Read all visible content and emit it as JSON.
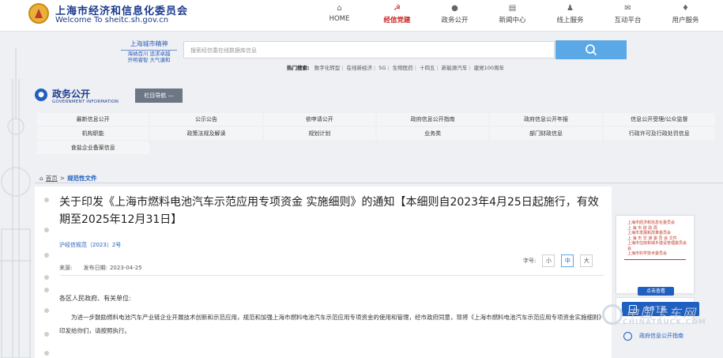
{
  "header": {
    "site_cn": "上海市经济和信息化委员会",
    "site_en": "Welcome To sheitc.sh.gov.cn",
    "nav": [
      {
        "label": "HOME",
        "icon": "home-icon",
        "active": false
      },
      {
        "label": "经信党建",
        "icon": "party-icon",
        "active": true
      },
      {
        "label": "政务公开",
        "icon": "chat-icon",
        "active": false
      },
      {
        "label": "新闻中心",
        "icon": "news-icon",
        "active": false
      },
      {
        "label": "线上服务",
        "icon": "service-icon",
        "active": false
      },
      {
        "label": "互动平台",
        "icon": "interact-icon",
        "active": false
      },
      {
        "label": "用户服务",
        "icon": "user-icon",
        "active": false
      }
    ]
  },
  "slogan": {
    "title": "上海城市精神",
    "line1": "海纳百川 追求卓越",
    "line2": "开明睿智 大气谦和"
  },
  "search": {
    "placeholder": "搜索经信委在线数据库信息",
    "hot_label": "热门搜索:",
    "hot_items": [
      "数字化转型",
      "在线新经济",
      "5G",
      "生物医药",
      "十四五",
      "新能源汽车",
      "建党100周年"
    ]
  },
  "section": {
    "title": "政务公开",
    "subtitle": "GOVERNMENT INFORMATION",
    "column_nav": "栏目导航 —"
  },
  "grid": [
    [
      "最新信息公开",
      "公示公告",
      "依申请公开",
      "政府信息公开指南",
      "政府信息公开年报",
      "信息公开受理/公众监督"
    ],
    [
      "机构职能",
      "政策法规及解读",
      "规划计划",
      "业务类",
      "部门财政信息",
      "行政许可及行政处罚信息"
    ],
    [
      "食盐企业备案信息"
    ]
  ],
  "breadcrumb": {
    "home": "首页",
    "current": "规范性文件"
  },
  "article": {
    "title": "关于印发《上海市燃料电池汽车示范应用专项资金 实施细则》的通知【本细则自2023年4月25日起施行，有效期至2025年12月31日】",
    "doc_no": "沪经信规范（2023）2号",
    "source_label": "来源:",
    "date_label": "发布日期:",
    "date": "2023-04-25",
    "font_label": "字号:",
    "font_sizes": [
      "小",
      "中",
      "大"
    ],
    "font_selected": "中",
    "salutation": "各区人民政府、有关单位:",
    "body": "为进一步鼓励燃料电池汽车产业链企业开展技术创新和示范应用，规范和加强上海市燃料电池汽车示范应用专项资金的使用和管理，经市政府同意，现将《上海市燃料电池汽车示范应用专项资金实施细则》印发给你们，请按照执行。"
  },
  "sidebar": {
    "doc_lines": [
      "上海市经济和信息化委员会",
      "上 海 市 财 政 局",
      "上海市发展和改革委员会",
      "上 海 市 交 通 委 员 会 文件",
      "上海市住房和城乡建设管理委员会",
      "会",
      "上海市科学技术委员会"
    ],
    "click_view": "点击查看",
    "doc_bar": "文件下载",
    "guide": "政府信息公开指南"
  },
  "watermark": {
    "cn": "中国卡车网",
    "en": "CHINATRUCK.COM"
  }
}
